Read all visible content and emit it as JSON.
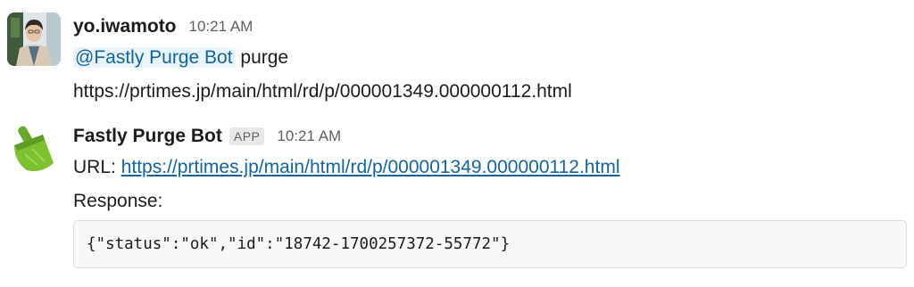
{
  "messages": [
    {
      "author": "yo.iwamoto",
      "time": "10:21 AM",
      "avatar_icon": "person-photo-icon",
      "mention": "@Fastly Purge Bot",
      "command": "purge",
      "url": "https://prtimes.jp/main/html/rd/p/000001349.000000112.html"
    },
    {
      "author": "Fastly Purge Bot",
      "badge": "APP",
      "time": "10:21 AM",
      "avatar_icon": "dustpan-icon",
      "url_label": "URL:",
      "url": "https://prtimes.jp/main/html/rd/p/000001349.000000112.html",
      "response_label": "Response:",
      "response_code": "{\"status\":\"ok\",\"id\":\"18742-1700257372-55772\"}"
    }
  ],
  "colors": {
    "link": "#1264a3",
    "mention_bg": "#e8f5fa",
    "dustpan_green": "#7cc12e",
    "code_bg": "#f8f8f8"
  }
}
